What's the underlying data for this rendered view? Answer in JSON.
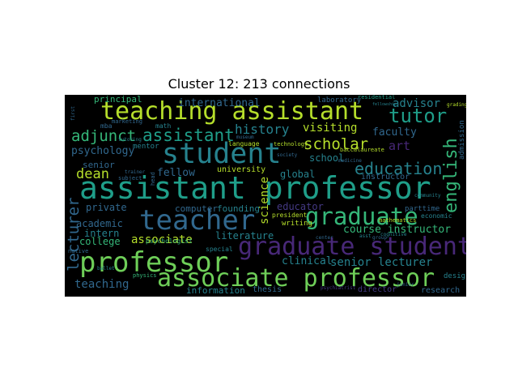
{
  "title": "Cluster 12: 213 connections",
  "words": [
    {
      "text": "assistant professor",
      "color": "#1f9e89"
    },
    {
      "text": "teaching assistant",
      "color": "#b5de2b"
    },
    {
      "text": "student",
      "color": "#26828e"
    },
    {
      "text": "teacher",
      "color": "#31688e"
    },
    {
      "text": "professor",
      "color": "#6ece58"
    },
    {
      "text": "graduate",
      "color": "#35b779"
    },
    {
      "text": "graduate student",
      "color": "#482878"
    },
    {
      "text": "associate professor",
      "color": "#6ece58"
    },
    {
      "text": "education",
      "color": "#26828e"
    },
    {
      "text": "english",
      "color": "#35b779"
    },
    {
      "text": "tutor",
      "color": "#1f9e89"
    },
    {
      "text": "adjunct",
      "color": "#35b779"
    },
    {
      "text": "assistant",
      "color": "#1f9e89"
    },
    {
      "text": "lecturer",
      "color": "#31688e"
    },
    {
      "text": "scholar",
      "color": "#b5de2b"
    },
    {
      "text": "history",
      "color": "#26828e"
    },
    {
      "text": "dean",
      "color": "#b5de2b"
    },
    {
      "text": "art",
      "color": "#482878"
    },
    {
      "text": "advisor",
      "color": "#26828e"
    },
    {
      "text": "faculty",
      "color": "#31688e"
    },
    {
      "text": "visiting",
      "color": "#b5de2b"
    },
    {
      "text": "international",
      "color": "#31688e"
    },
    {
      "text": "psychology",
      "color": "#31688e"
    },
    {
      "text": "fellow",
      "color": "#31688e"
    },
    {
      "text": "school",
      "color": "#26828e"
    },
    {
      "text": "global",
      "color": "#26828e"
    },
    {
      "text": "science",
      "color": "#b5de2b"
    },
    {
      "text": "educator",
      "color": "#443983"
    },
    {
      "text": "senior lecturer",
      "color": "#26828e"
    },
    {
      "text": "course instructor",
      "color": "#35b779"
    },
    {
      "text": "associate",
      "color": "#b5de2b"
    },
    {
      "text": "literature",
      "color": "#26828e"
    },
    {
      "text": "clinical",
      "color": "#26828e"
    },
    {
      "text": "teaching",
      "color": "#31688e"
    },
    {
      "text": "private",
      "color": "#31688e"
    },
    {
      "text": "computer",
      "color": "#31688e"
    },
    {
      "text": "intern",
      "color": "#26828e"
    },
    {
      "text": "college",
      "color": "#35b779"
    },
    {
      "text": "academic",
      "color": "#31688e"
    },
    {
      "text": "founding",
      "color": "#26828e"
    },
    {
      "text": "principal",
      "color": "#35b779"
    },
    {
      "text": "senior",
      "color": "#31688e"
    },
    {
      "text": "university",
      "color": "#b5de2b"
    },
    {
      "text": "instructor",
      "color": "#31688e"
    },
    {
      "text": "information",
      "color": "#26828e"
    },
    {
      "text": "thesis",
      "color": "#31688e"
    },
    {
      "text": "director",
      "color": "#443983"
    },
    {
      "text": "research",
      "color": "#31688e"
    },
    {
      "text": "design",
      "color": "#26828e"
    },
    {
      "text": "admission",
      "color": "#31688e"
    },
    {
      "text": "laboratory",
      "color": "#31688e"
    },
    {
      "text": "residential",
      "color": "#1f9e89"
    },
    {
      "text": "president",
      "color": "#b5de2b"
    },
    {
      "text": "writing",
      "color": "#b5de2b"
    },
    {
      "text": "parttime",
      "color": "#31688e"
    },
    {
      "text": "economic",
      "color": "#26828e"
    },
    {
      "text": "mentor",
      "color": "#26828e"
    },
    {
      "text": "math",
      "color": "#26828e"
    },
    {
      "text": "language",
      "color": "#b5de2b"
    },
    {
      "text": "psychologist",
      "color": "#35b779"
    },
    {
      "text": "special",
      "color": "#26828e"
    },
    {
      "text": "mathematics",
      "color": "#b5de2b"
    },
    {
      "text": "baccalaureate",
      "color": "#b5de2b"
    },
    {
      "text": "physics",
      "color": "#35b779"
    },
    {
      "text": "native",
      "color": "#31688e"
    },
    {
      "text": "mba",
      "color": "#31688e"
    },
    {
      "text": "marketing",
      "color": "#31688e"
    },
    {
      "text": "psychiatrist",
      "color": "#443983"
    },
    {
      "text": "junior",
      "color": "#31688e"
    },
    {
      "text": "technology",
      "color": "#b5de2b"
    },
    {
      "text": "society",
      "color": "#31688e"
    },
    {
      "text": "cognitive",
      "color": "#26828e"
    },
    {
      "text": "subject",
      "color": "#31688e"
    },
    {
      "text": "trainer",
      "color": "#31688e"
    },
    {
      "text": "ballet",
      "color": "#26828e"
    },
    {
      "text": "head",
      "color": "#31688e"
    },
    {
      "text": "community",
      "color": "#26828e"
    },
    {
      "text": "grading",
      "color": "#b5de2b"
    },
    {
      "text": "medicine",
      "color": "#31688e"
    },
    {
      "text": "museum",
      "color": "#31688e"
    },
    {
      "text": "tutoring",
      "color": "#26828e"
    },
    {
      "text": "first",
      "color": "#31688e"
    },
    {
      "text": "asst",
      "color": "#26828e"
    },
    {
      "text": "group",
      "color": "#31688e"
    },
    {
      "text": "center",
      "color": "#31688e"
    },
    {
      "text": "fellowship",
      "color": "#26828e"
    }
  ]
}
